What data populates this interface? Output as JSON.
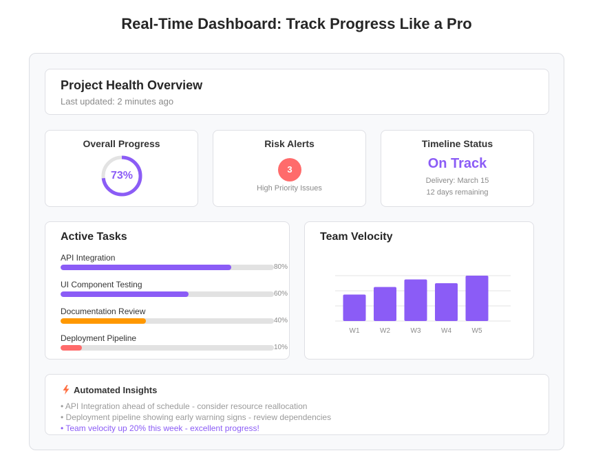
{
  "page": {
    "title": "Real-Time Dashboard: Track Progress Like a Pro"
  },
  "overview": {
    "title": "Project Health Overview",
    "last_updated": "Last updated: 2 minutes ago"
  },
  "metrics": {
    "progress": {
      "title": "Overall Progress",
      "value_label": "73%",
      "value": 0.73,
      "color": "#8b5cf6"
    },
    "risk": {
      "title": "Risk Alerts",
      "count": "3",
      "subtitle": "High Priority Issues",
      "color": "#ff6b6b"
    },
    "timeline": {
      "title": "Timeline Status",
      "status": "On Track",
      "delivery": "Delivery: March 15",
      "remaining": "12 days remaining"
    }
  },
  "tasks": {
    "title": "Active Tasks",
    "items": [
      {
        "label": "API Integration",
        "percent_label": "80%",
        "value": 80,
        "color": "#8b5cf6"
      },
      {
        "label": "UI Component Testing",
        "percent_label": "60%",
        "value": 60,
        "color": "#8b5cf6"
      },
      {
        "label": "Documentation Review",
        "percent_label": "40%",
        "value": 40,
        "color": "#ff9800"
      },
      {
        "label": "Deployment Pipeline",
        "percent_label": "10%",
        "value": 10,
        "color": "#ff6b6b"
      }
    ]
  },
  "velocity": {
    "title": "Team Velocity",
    "chart_data": {
      "type": "bar",
      "categories": [
        "W1",
        "W2",
        "W3",
        "W4",
        "W5"
      ],
      "values": [
        35,
        45,
        55,
        50,
        60
      ],
      "ylim": [
        0,
        60
      ],
      "grid": true,
      "color": "#8b5cf6"
    }
  },
  "insights": {
    "title": "Automated Insights",
    "icon": "lightning-icon",
    "items": [
      {
        "text": "• API Integration ahead of schedule - consider resource reallocation",
        "highlight": false
      },
      {
        "text": "• Deployment pipeline showing early warning signs - review dependencies",
        "highlight": false
      },
      {
        "text": "• Team velocity up 20% this week - excellent progress!",
        "highlight": true
      }
    ]
  }
}
